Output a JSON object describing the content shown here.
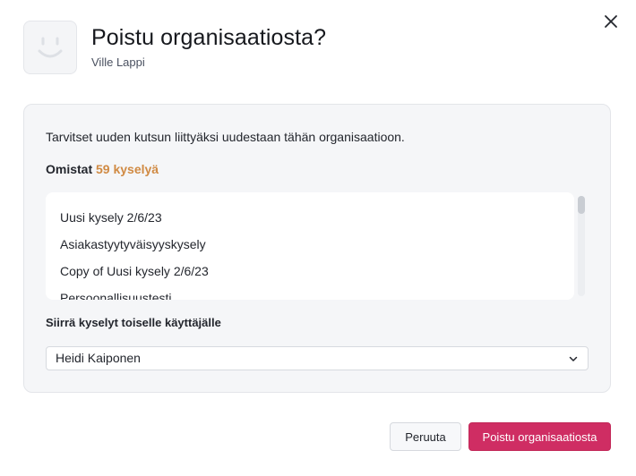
{
  "dialog": {
    "title": "Poistu organisaatiosta?",
    "user_name": "Ville Lappi",
    "close_icon": "close-icon",
    "avatar_icon": "smiley-face-icon"
  },
  "panel": {
    "info_text": "Tarvitset uuden kutsun liittyäksi uudestaan tähän organisaatioon.",
    "owns_prefix": "Omistat",
    "owns_count": "59 kyselyä",
    "surveys": [
      "Uusi kysely 2/6/23",
      "Asiakastyytyväisyyskysely",
      "Copy of Uusi kysely 2/6/23",
      "Persoonallisuustesti"
    ],
    "transfer_label": "Siirrä kyselyt toiselle käyttäjälle",
    "transfer_selected": "Heidi Kaiponen"
  },
  "footer": {
    "cancel_label": "Peruuta",
    "leave_label": "Poistu organisaatiosta"
  },
  "colors": {
    "accent": "#cf2d63",
    "count_highlight": "#d08a43"
  }
}
